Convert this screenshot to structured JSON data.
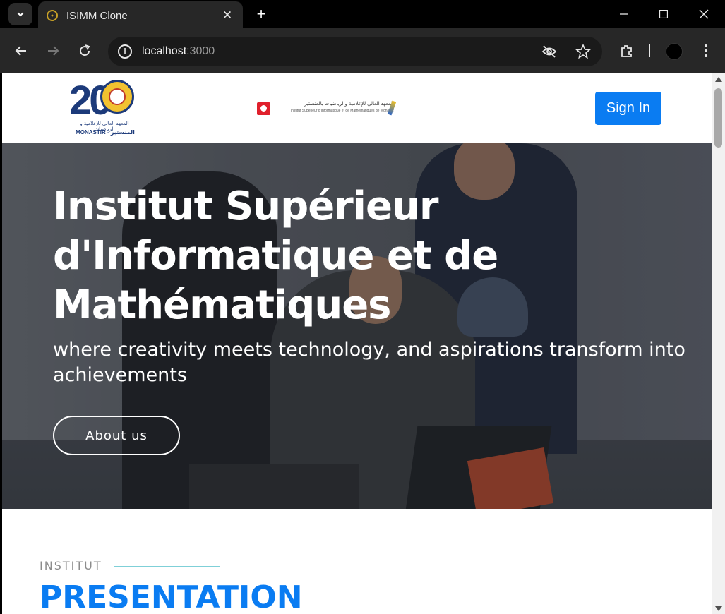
{
  "browser": {
    "tab_title": "ISIMM Clone",
    "url_host": "localhost",
    "url_port": ":3000"
  },
  "navbar": {
    "logo_digits": "20",
    "logo_arabic": "المعهد العالي للإعلامية و الرياضيات",
    "logo_city": "MONASTIR - المنستير",
    "inst_text_ar": "المعهد العالي للإعلامية والرياضيات بالمنستير",
    "inst_text_fr": "Institut Supérieur d'Informatique et de Mathématiques de Monastir",
    "signin_label": "Sign In",
    "signin_color": "#0a7cf2"
  },
  "hero": {
    "title": "Institut Supérieur d'Informatique et de Mathématiques",
    "subtitle": "where creativity meets technology, and aspirations transform into achievements",
    "cta_label": "About us"
  },
  "section": {
    "kicker": "INSTITUT",
    "title": "PRESENTATION",
    "accent_color": "#0a7cf2"
  }
}
